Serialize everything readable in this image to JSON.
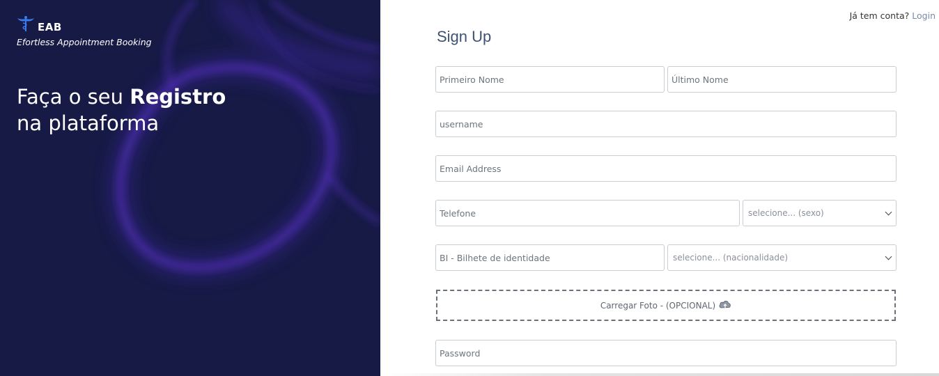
{
  "brand": {
    "name": "EAB",
    "tagline": "Efortless Appointment Booking",
    "logo_icon": "caduceus-icon"
  },
  "headline": {
    "line1_prefix": "Faça o seu ",
    "line1_bold": "Registro",
    "line2": "na plataforma"
  },
  "header": {
    "login_prompt": "Já tem conta?",
    "login_link": "Login"
  },
  "form": {
    "title": "Sign Up",
    "first_name_placeholder": "Primeiro Nome",
    "last_name_placeholder": "Último Nome",
    "username_placeholder": "username",
    "email_placeholder": "Email Address",
    "phone_placeholder": "Telefone",
    "gender_select": "selecione... (sexo)",
    "id_placeholder": "BI - Bilhete de identidade",
    "nationality_select": "selecione... (nacionalidade)",
    "upload_label": "Carregar Foto - (OPCIONAL)",
    "upload_icon": "cloud-upload-icon",
    "password_placeholder": "Password"
  },
  "colors": {
    "left_panel_bg": "#161a45",
    "glow": "#5a2fd0",
    "title": "#3d5371",
    "link": "#7a8ba6"
  }
}
